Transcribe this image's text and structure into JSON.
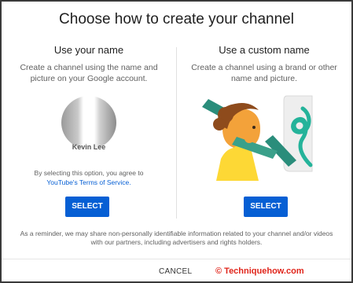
{
  "dialog": {
    "title": "Choose how to create your channel",
    "reminder": "As a reminder, we may share non-personally identifiable information related to your channel and/or videos with our partners, including advertisers and rights holders.",
    "cancel_label": "CANCEL"
  },
  "left": {
    "title": "Use your name",
    "description": "Create a channel using the name and picture on your Google account.",
    "avatar_name": "Kevin Lee",
    "consent_prefix": "By selecting this option, you agree to",
    "consent_link": "YouTube's Terms of Service.",
    "select_label": "SELECT"
  },
  "right": {
    "title": "Use a custom name",
    "description": "Create a channel using a brand or other name and picture.",
    "select_label": "SELECT"
  },
  "watermark": "© Techniquehow.com"
}
